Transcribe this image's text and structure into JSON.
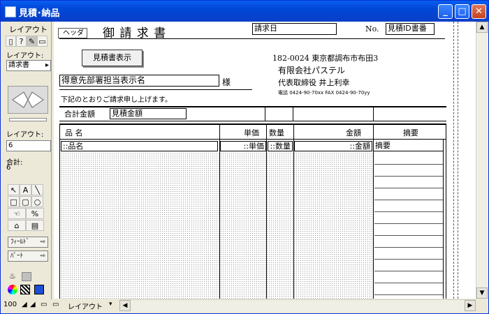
{
  "window": {
    "title": "見積･納品"
  },
  "tools": {
    "top_label": "レイアウト",
    "layout_label": "レイアウト:",
    "layout_value": "請求書",
    "layout2_label": "レイアウト:",
    "layout2_value": "6",
    "total_label": "合計:",
    "total_value": "6",
    "field_button": "ﾌｨｰﾙﾄﾞ",
    "part_button": "ﾊﾟｰﾄ"
  },
  "layout": {
    "header_part": "ヘッダ",
    "doc_title": "御 請 求 書",
    "date_field": "請求日",
    "no_label": "No.",
    "no_field": "見積ID書番",
    "show_estimate_button": "見積書表示",
    "customer_field": "得意先部署担当表示名",
    "honorific": "様",
    "intro_text": "下記のとおりご請求申し上げます。",
    "company_address": "182-0024  東京都調布市布田3",
    "company_name": "有限会社パステル",
    "company_rep": "代表取締役   井上利幸",
    "company_tel": "電話 0424-90-70xx FAX 0424-90-70yy",
    "total_label": "合計金額",
    "total_field": "見積金額",
    "col_item": "品    名",
    "col_price": "単価",
    "col_qty": "数量",
    "col_amount": "金額",
    "col_note": "摘要",
    "row_item": "::品名",
    "row_price": "::単価",
    "row_qty": "::数量",
    "row_amount": "::金額",
    "row_note": "摘要"
  },
  "status": {
    "zoom": "100",
    "mode": "レイアウト"
  }
}
